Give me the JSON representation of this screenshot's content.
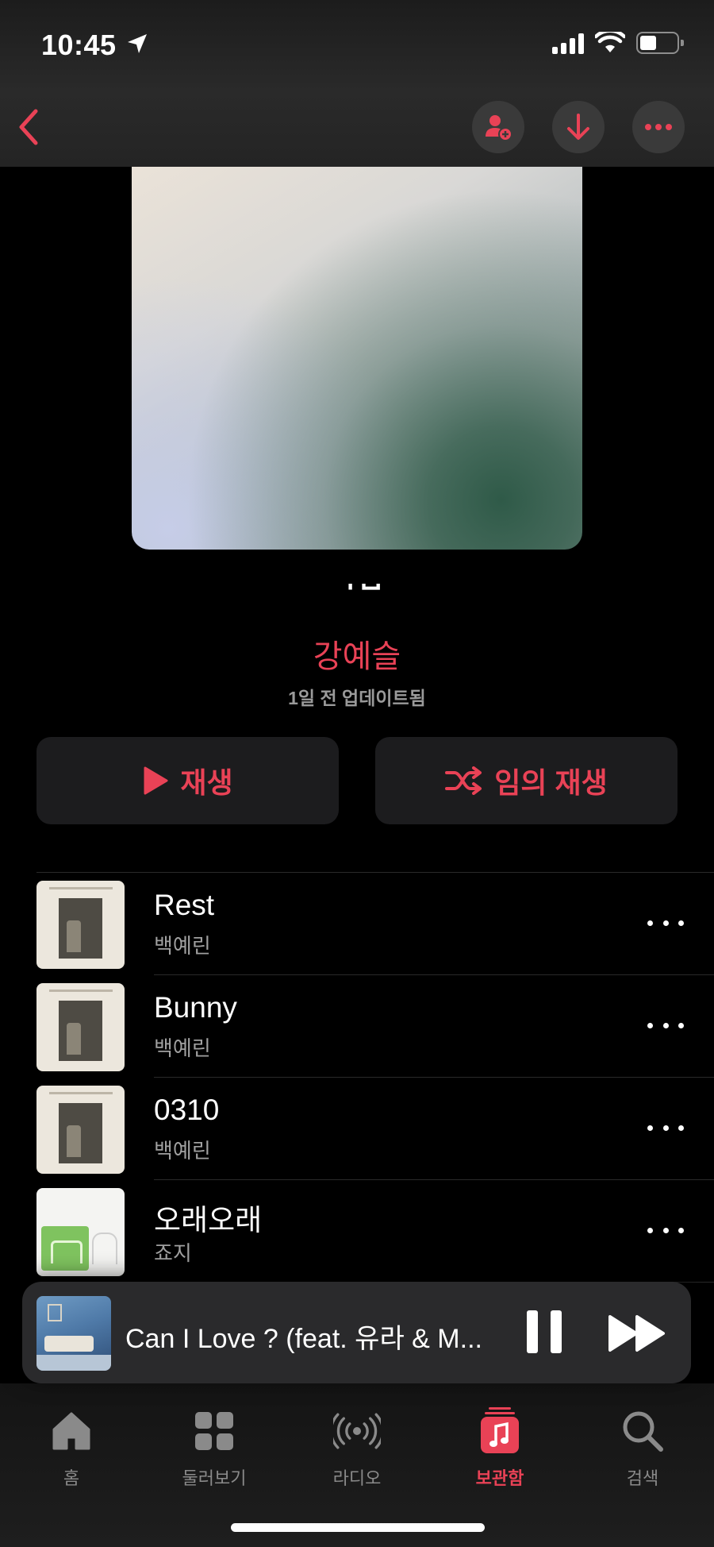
{
  "status_bar": {
    "time": "10:45"
  },
  "playlist": {
    "title": "ㄱㅂ",
    "curator": "강예슬",
    "updated": "1일 전 업데이트됨"
  },
  "actions": {
    "play_label": "재생",
    "shuffle_label": "임의 재생"
  },
  "tracks": [
    {
      "title": "Rest",
      "artist": "백예린"
    },
    {
      "title": "Bunny",
      "artist": "백예린"
    },
    {
      "title": "0310",
      "artist": "백예린"
    },
    {
      "title": "오래오래",
      "artist": "죠지"
    }
  ],
  "now_playing": {
    "title": "Can I Love ? (feat. 유라 & M..."
  },
  "tabs": [
    {
      "label": "홈",
      "icon": "home-icon"
    },
    {
      "label": "둘러보기",
      "icon": "browse-grid-icon"
    },
    {
      "label": "라디오",
      "icon": "radio-icon"
    },
    {
      "label": "보관함",
      "icon": "library-icon",
      "active": true
    },
    {
      "label": "검색",
      "icon": "search-icon"
    }
  ],
  "colors": {
    "accent": "#e94256",
    "background": "#000000",
    "button_bg": "#1c1c1e"
  }
}
